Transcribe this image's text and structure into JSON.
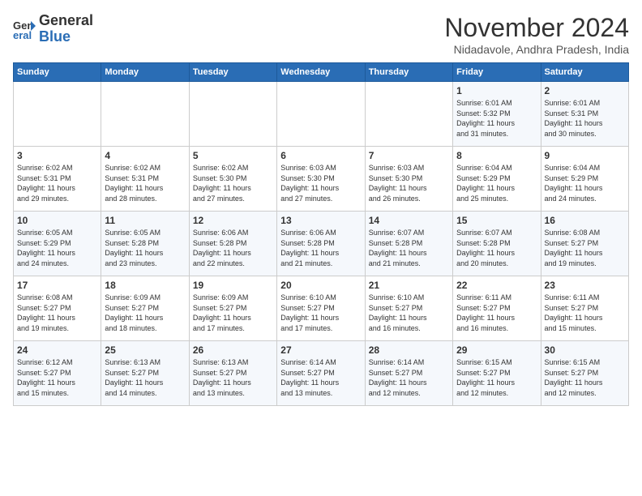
{
  "header": {
    "logo_line1": "General",
    "logo_line2": "Blue",
    "month_title": "November 2024",
    "location": "Nidadavole, Andhra Pradesh, India"
  },
  "days_of_week": [
    "Sunday",
    "Monday",
    "Tuesday",
    "Wednesday",
    "Thursday",
    "Friday",
    "Saturday"
  ],
  "weeks": [
    [
      {
        "day": "",
        "info": ""
      },
      {
        "day": "",
        "info": ""
      },
      {
        "day": "",
        "info": ""
      },
      {
        "day": "",
        "info": ""
      },
      {
        "day": "",
        "info": ""
      },
      {
        "day": "1",
        "info": "Sunrise: 6:01 AM\nSunset: 5:32 PM\nDaylight: 11 hours\nand 31 minutes."
      },
      {
        "day": "2",
        "info": "Sunrise: 6:01 AM\nSunset: 5:31 PM\nDaylight: 11 hours\nand 30 minutes."
      }
    ],
    [
      {
        "day": "3",
        "info": "Sunrise: 6:02 AM\nSunset: 5:31 PM\nDaylight: 11 hours\nand 29 minutes."
      },
      {
        "day": "4",
        "info": "Sunrise: 6:02 AM\nSunset: 5:31 PM\nDaylight: 11 hours\nand 28 minutes."
      },
      {
        "day": "5",
        "info": "Sunrise: 6:02 AM\nSunset: 5:30 PM\nDaylight: 11 hours\nand 27 minutes."
      },
      {
        "day": "6",
        "info": "Sunrise: 6:03 AM\nSunset: 5:30 PM\nDaylight: 11 hours\nand 27 minutes."
      },
      {
        "day": "7",
        "info": "Sunrise: 6:03 AM\nSunset: 5:30 PM\nDaylight: 11 hours\nand 26 minutes."
      },
      {
        "day": "8",
        "info": "Sunrise: 6:04 AM\nSunset: 5:29 PM\nDaylight: 11 hours\nand 25 minutes."
      },
      {
        "day": "9",
        "info": "Sunrise: 6:04 AM\nSunset: 5:29 PM\nDaylight: 11 hours\nand 24 minutes."
      }
    ],
    [
      {
        "day": "10",
        "info": "Sunrise: 6:05 AM\nSunset: 5:29 PM\nDaylight: 11 hours\nand 24 minutes."
      },
      {
        "day": "11",
        "info": "Sunrise: 6:05 AM\nSunset: 5:28 PM\nDaylight: 11 hours\nand 23 minutes."
      },
      {
        "day": "12",
        "info": "Sunrise: 6:06 AM\nSunset: 5:28 PM\nDaylight: 11 hours\nand 22 minutes."
      },
      {
        "day": "13",
        "info": "Sunrise: 6:06 AM\nSunset: 5:28 PM\nDaylight: 11 hours\nand 21 minutes."
      },
      {
        "day": "14",
        "info": "Sunrise: 6:07 AM\nSunset: 5:28 PM\nDaylight: 11 hours\nand 21 minutes."
      },
      {
        "day": "15",
        "info": "Sunrise: 6:07 AM\nSunset: 5:28 PM\nDaylight: 11 hours\nand 20 minutes."
      },
      {
        "day": "16",
        "info": "Sunrise: 6:08 AM\nSunset: 5:27 PM\nDaylight: 11 hours\nand 19 minutes."
      }
    ],
    [
      {
        "day": "17",
        "info": "Sunrise: 6:08 AM\nSunset: 5:27 PM\nDaylight: 11 hours\nand 19 minutes."
      },
      {
        "day": "18",
        "info": "Sunrise: 6:09 AM\nSunset: 5:27 PM\nDaylight: 11 hours\nand 18 minutes."
      },
      {
        "day": "19",
        "info": "Sunrise: 6:09 AM\nSunset: 5:27 PM\nDaylight: 11 hours\nand 17 minutes."
      },
      {
        "day": "20",
        "info": "Sunrise: 6:10 AM\nSunset: 5:27 PM\nDaylight: 11 hours\nand 17 minutes."
      },
      {
        "day": "21",
        "info": "Sunrise: 6:10 AM\nSunset: 5:27 PM\nDaylight: 11 hours\nand 16 minutes."
      },
      {
        "day": "22",
        "info": "Sunrise: 6:11 AM\nSunset: 5:27 PM\nDaylight: 11 hours\nand 16 minutes."
      },
      {
        "day": "23",
        "info": "Sunrise: 6:11 AM\nSunset: 5:27 PM\nDaylight: 11 hours\nand 15 minutes."
      }
    ],
    [
      {
        "day": "24",
        "info": "Sunrise: 6:12 AM\nSunset: 5:27 PM\nDaylight: 11 hours\nand 15 minutes."
      },
      {
        "day": "25",
        "info": "Sunrise: 6:13 AM\nSunset: 5:27 PM\nDaylight: 11 hours\nand 14 minutes."
      },
      {
        "day": "26",
        "info": "Sunrise: 6:13 AM\nSunset: 5:27 PM\nDaylight: 11 hours\nand 13 minutes."
      },
      {
        "day": "27",
        "info": "Sunrise: 6:14 AM\nSunset: 5:27 PM\nDaylight: 11 hours\nand 13 minutes."
      },
      {
        "day": "28",
        "info": "Sunrise: 6:14 AM\nSunset: 5:27 PM\nDaylight: 11 hours\nand 12 minutes."
      },
      {
        "day": "29",
        "info": "Sunrise: 6:15 AM\nSunset: 5:27 PM\nDaylight: 11 hours\nand 12 minutes."
      },
      {
        "day": "30",
        "info": "Sunrise: 6:15 AM\nSunset: 5:27 PM\nDaylight: 11 hours\nand 12 minutes."
      }
    ]
  ]
}
